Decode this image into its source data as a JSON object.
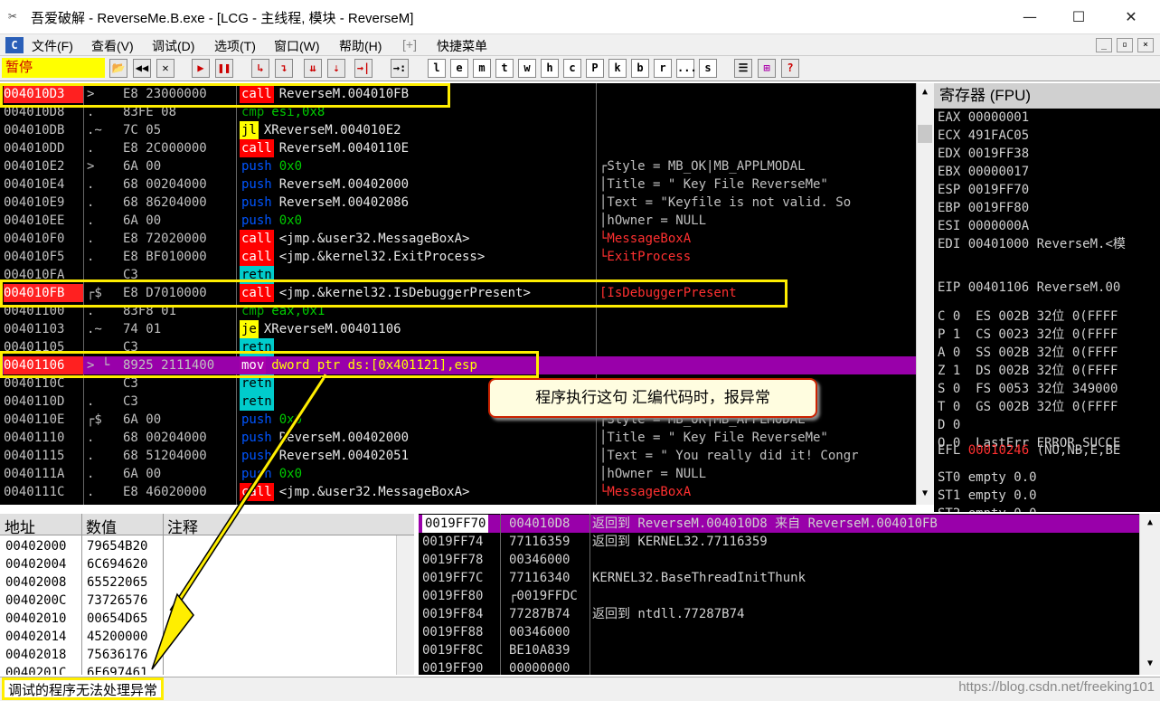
{
  "window": {
    "title": "吾爱破解 - ReverseMe.B.exe - [LCG - 主线程, 模块 - ReverseM]",
    "min": "—",
    "max": "☐",
    "close": "✕"
  },
  "menu": {
    "items": [
      "文件(F)",
      "查看(V)",
      "调试(D)",
      "选项(T)",
      "窗口(W)",
      "帮助(H)",
      "[+]",
      "快捷菜单"
    ],
    "app_icon": "C"
  },
  "toolbar": {
    "status": "暂停",
    "buttons": [
      "📂",
      "◀◀",
      "✕",
      "▶",
      "❚❚",
      "↳",
      "↴",
      "⇊",
      "⇣",
      "→|",
      "→:",
      "l",
      "e",
      "m",
      "t",
      "w",
      "h",
      "c",
      "P",
      "k",
      "b",
      "r",
      "...",
      "s",
      "☰",
      "⊞",
      "?"
    ]
  },
  "disasm": {
    "rows": [
      {
        "addr": "004010D3",
        "sym": ">",
        "hex": "E8 23000000",
        "mn": "call",
        "mc": "call",
        "op": "ReverseM.004010FB",
        "cmt": ""
      },
      {
        "addr": "004010D8",
        "sym": ".",
        "hex": "83FE 08",
        "mn": "cmp",
        "mc": "cmp",
        "op": "esi,0x8",
        "cmt": ""
      },
      {
        "addr": "004010DB",
        "sym": ".~",
        "hex": "7C 05",
        "mn": "jl",
        "mc": "jl",
        "op": "XReverseM.004010E2",
        "cmt": ""
      },
      {
        "addr": "004010DD",
        "sym": ".",
        "hex": "E8 2C000000",
        "mn": "call",
        "mc": "call",
        "op": "ReverseM.0040110E",
        "cmt": ""
      },
      {
        "addr": "004010E2",
        "sym": ">",
        "hex": "6A 00",
        "mn": "push",
        "mc": "push",
        "op": "0x0",
        "cmt": "┌Style = MB_OK|MB_APPLMODAL"
      },
      {
        "addr": "004010E4",
        "sym": ".",
        "hex": "68 00204000",
        "mn": "push",
        "mc": "push",
        "op": "ReverseM.00402000",
        "cmt": "│Title = \" Key File ReverseMe\""
      },
      {
        "addr": "004010E9",
        "sym": ".",
        "hex": "68 86204000",
        "mn": "push",
        "mc": "push",
        "op": "ReverseM.00402086",
        "cmt": "│Text = \"Keyfile is not valid. So"
      },
      {
        "addr": "004010EE",
        "sym": ".",
        "hex": "6A 00",
        "mn": "push",
        "mc": "push",
        "op": "0x0",
        "cmt": "│hOwner = NULL"
      },
      {
        "addr": "004010F0",
        "sym": ".",
        "hex": "E8 72020000",
        "mn": "call",
        "mc": "call",
        "op": "<jmp.&user32.MessageBoxA>",
        "cmt": "└MessageBoxA"
      },
      {
        "addr": "004010F5",
        "sym": ".",
        "hex": "E8 BF010000",
        "mn": "call",
        "mc": "call",
        "op": "<jmp.&kernel32.ExitProcess>",
        "cmt": "└ExitProcess"
      },
      {
        "addr": "004010FA",
        "sym": "",
        "hex": "C3",
        "mn": "retn",
        "mc": "retn",
        "op": "",
        "cmt": ""
      },
      {
        "addr": "004010FB",
        "sym": "┌$",
        "hex": "E8 D7010000",
        "mn": "call",
        "mc": "call",
        "op": "<jmp.&kernel32.IsDebuggerPresent>",
        "cmt": "[IsDebuggerPresent"
      },
      {
        "addr": "00401100",
        "sym": ".",
        "hex": "83F8 01",
        "mn": "cmp",
        "mc": "cmp",
        "op": "eax,0x1",
        "cmt": ""
      },
      {
        "addr": "00401103",
        "sym": ".~",
        "hex": "74 01",
        "mn": "je",
        "mc": "jl",
        "op": "XReverseM.00401106",
        "cmt": ""
      },
      {
        "addr": "00401105",
        "sym": "",
        "hex": "C3",
        "mn": "retn",
        "mc": "retn",
        "op": "",
        "cmt": ""
      },
      {
        "addr": "00401106",
        "sym": "> └",
        "hex": "8925 2111400",
        "mn": "mov",
        "mc": "mov",
        "op": "dword ptr ds:[0x401121],esp",
        "cmt": ""
      },
      {
        "addr": "0040110C",
        "sym": "",
        "hex": "C3",
        "mn": "retn",
        "mc": "retn",
        "op": "",
        "cmt": ""
      },
      {
        "addr": "0040110D",
        "sym": ".",
        "hex": "C3",
        "mn": "retn",
        "mc": "retn",
        "op": "",
        "cmt": ""
      },
      {
        "addr": "0040110E",
        "sym": "┌$",
        "hex": "6A 00",
        "mn": "push",
        "mc": "push",
        "op": "0x0",
        "cmt": "┌Style = MB_OK|MB_APPLMODAL"
      },
      {
        "addr": "00401110",
        "sym": ".",
        "hex": "68 00204000",
        "mn": "push",
        "mc": "push",
        "op": "ReverseM.00402000",
        "cmt": "│Title = \" Key File ReverseMe\""
      },
      {
        "addr": "00401115",
        "sym": ".",
        "hex": "68 51204000",
        "mn": "push",
        "mc": "push",
        "op": "ReverseM.00402051",
        "cmt": "│Text = \" You really did it! Congr"
      },
      {
        "addr": "0040111A",
        "sym": ".",
        "hex": "6A 00",
        "mn": "push",
        "mc": "push",
        "op": "0x0",
        "cmt": "│hOwner = NULL"
      },
      {
        "addr": "0040111C",
        "sym": ".",
        "hex": "E8 46020000",
        "mn": "call",
        "mc": "call",
        "op": "<jmp.&user32.MessageBoxA>",
        "cmt": "└MessageBoxA"
      }
    ]
  },
  "registers": {
    "header": "寄存器 (FPU)",
    "lines": [
      {
        "name": "EAX",
        "value": "00000001",
        "extra": ""
      },
      {
        "name": "ECX",
        "value": "491FAC05",
        "extra": ""
      },
      {
        "name": "EDX",
        "value": "0019FF38",
        "extra": ""
      },
      {
        "name": "EBX",
        "value": "00000017",
        "extra": ""
      },
      {
        "name": "ESP",
        "value": "0019FF70",
        "extra": ""
      },
      {
        "name": "EBP",
        "value": "0019FF80",
        "extra": ""
      },
      {
        "name": "ESI",
        "value": "0000000A",
        "extra": ""
      },
      {
        "name": "EDI",
        "value": "00401000",
        "extra": "ReverseM.<模"
      },
      {
        "name": "",
        "value": "",
        "extra": ""
      },
      {
        "name": "EIP",
        "value": "00401106",
        "extra": "ReverseM.00"
      }
    ],
    "flags": [
      "C 0  ES 002B 32位 0(FFFF",
      "P 1  CS 0023 32位 0(FFFF",
      "A 0  SS 002B 32位 0(FFFF",
      "Z 1  DS 002B 32位 0(FFFF",
      "S 0  FS 0053 32位 349000",
      "T 0  GS 002B 32位 0(FFFF",
      "D 0",
      "O 0  LastErr ERROR_SUCCE"
    ],
    "efl": {
      "name": "EFL",
      "value": "00010246",
      "extra": "(NO,NB,E,BE"
    },
    "fpu": [
      "ST0 empty 0.0",
      "ST1 empty 0.0",
      "ST2 empty 0.0"
    ]
  },
  "dump": {
    "headers": [
      "地址",
      "数值",
      "注释"
    ],
    "rows": [
      {
        "addr": "00402000",
        "val": "79654B20"
      },
      {
        "addr": "00402004",
        "val": "6C694620"
      },
      {
        "addr": "00402008",
        "val": "65522065"
      },
      {
        "addr": "0040200C",
        "val": "73726576"
      },
      {
        "addr": "00402010",
        "val": "00654D65"
      },
      {
        "addr": "00402014",
        "val": "45200000"
      },
      {
        "addr": "00402018",
        "val": "75636176"
      },
      {
        "addr": "0040201C",
        "val": "6F697461"
      }
    ]
  },
  "stack": {
    "rows": [
      {
        "addr": "0019FF70",
        "val": "004010D8",
        "cmt": "返回到 ReverseM.004010D8 来自 ReverseM.004010FB"
      },
      {
        "addr": "0019FF74",
        "val": "77116359",
        "cmt": "返回到 KERNEL32.77116359"
      },
      {
        "addr": "0019FF78",
        "val": "00346000",
        "cmt": ""
      },
      {
        "addr": "0019FF7C",
        "val": "77116340",
        "cmt": "KERNEL32.BaseThreadInitThunk"
      },
      {
        "addr": "0019FF80",
        "val": "┌0019FFDC",
        "cmt": ""
      },
      {
        "addr": "0019FF84",
        "val": "77287B74",
        "cmt": "返回到 ntdll.77287B74"
      },
      {
        "addr": "0019FF88",
        "val": "00346000",
        "cmt": ""
      },
      {
        "addr": "0019FF8C",
        "val": "BE10A839",
        "cmt": ""
      },
      {
        "addr": "0019FF90",
        "val": "00000000",
        "cmt": ""
      }
    ]
  },
  "callout": {
    "text": "程序执行这句 汇编代码时，报异常"
  },
  "statusbar": {
    "message": "调试的程序无法处理异常",
    "watermark": "https://blog.csdn.net/freeking101"
  }
}
